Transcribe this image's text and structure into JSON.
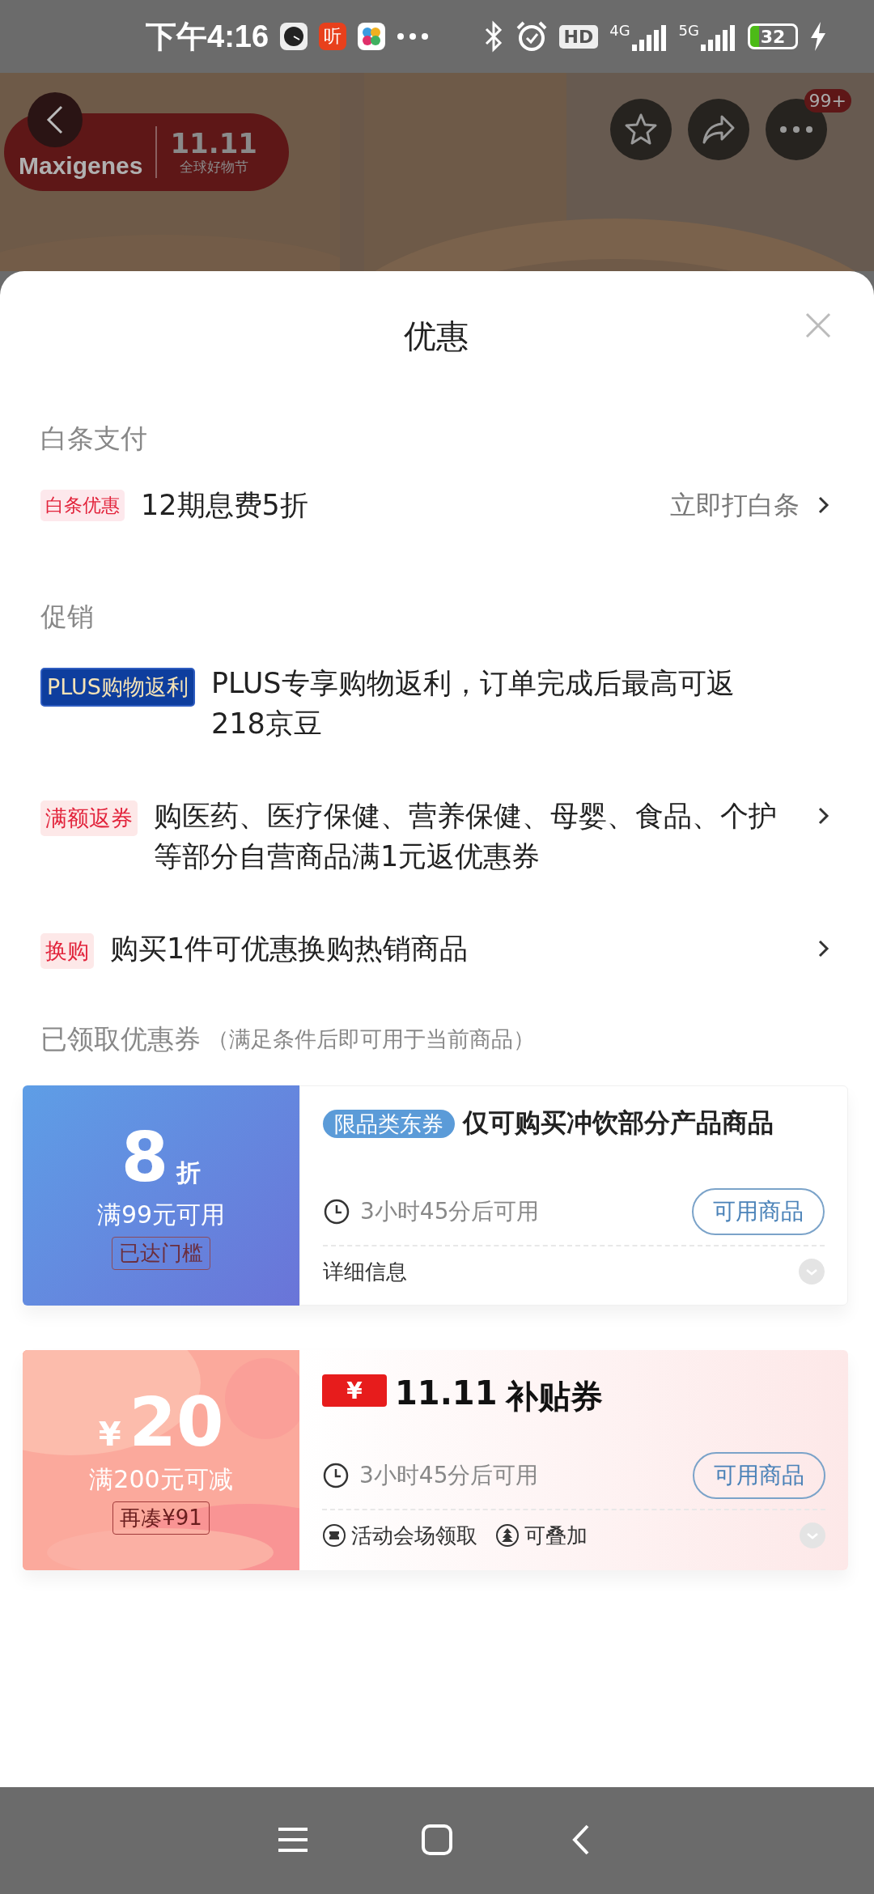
{
  "status_bar": {
    "time": "下午4:16",
    "app_badge": "听",
    "network_1": "4G",
    "network_2": "5G",
    "hd": "HD",
    "battery": "32"
  },
  "header": {
    "brand": "Maxigenes",
    "event_mark": "11.11",
    "event_name": "全球好物节",
    "more_badge": "99+"
  },
  "sheet": {
    "title": "优惠"
  },
  "sections": [
    {
      "title": "白条支付",
      "rows": [
        {
          "tag": "白条优惠",
          "kind": "pink",
          "text": "12期息费5折",
          "action": "立即打白条",
          "arrow": true
        }
      ]
    },
    {
      "title": "促销",
      "rows": [
        {
          "tag": "PLUS购物返利",
          "kind": "plus",
          "text": "PLUS专享购物返利，订单完成后最高可返218京豆",
          "arrow": false
        },
        {
          "tag": "满额返券",
          "kind": "red",
          "text": "购医药、医疗保健、营养保健、母婴、食品、个护等部分自营商品满1元返优惠券",
          "arrow": true
        },
        {
          "tag": "换购",
          "kind": "red",
          "text": "购买1件可优惠换购热销商品",
          "arrow": true
        }
      ]
    }
  ],
  "coupon_section": {
    "title": "已领取优惠券",
    "note": "（满足条件后即可用于当前商品）"
  },
  "coupons": [
    {
      "kind": "discount",
      "amount": "8",
      "unit": "折",
      "condition": "满99元可用",
      "status": "已达门槛",
      "tag": "限品类东券",
      "title": "仅可购买冲饮部分产品商品",
      "timer": "3小时45分后可用",
      "button": "可用商品",
      "footer": [
        {
          "kind": "text",
          "label": "详细信息"
        }
      ]
    },
    {
      "kind": "subsidy",
      "currency": "¥",
      "amount": "20",
      "condition": "满200元可减",
      "status": "再凑¥91",
      "title_badge": "¥",
      "title_mark": "11.11",
      "title": "补贴券",
      "timer": "3小时45分后可用",
      "button": "可用商品",
      "footer": [
        {
          "kind": "venue",
          "label": "活动会场领取"
        },
        {
          "kind": "stack",
          "label": "可叠加"
        }
      ]
    }
  ]
}
